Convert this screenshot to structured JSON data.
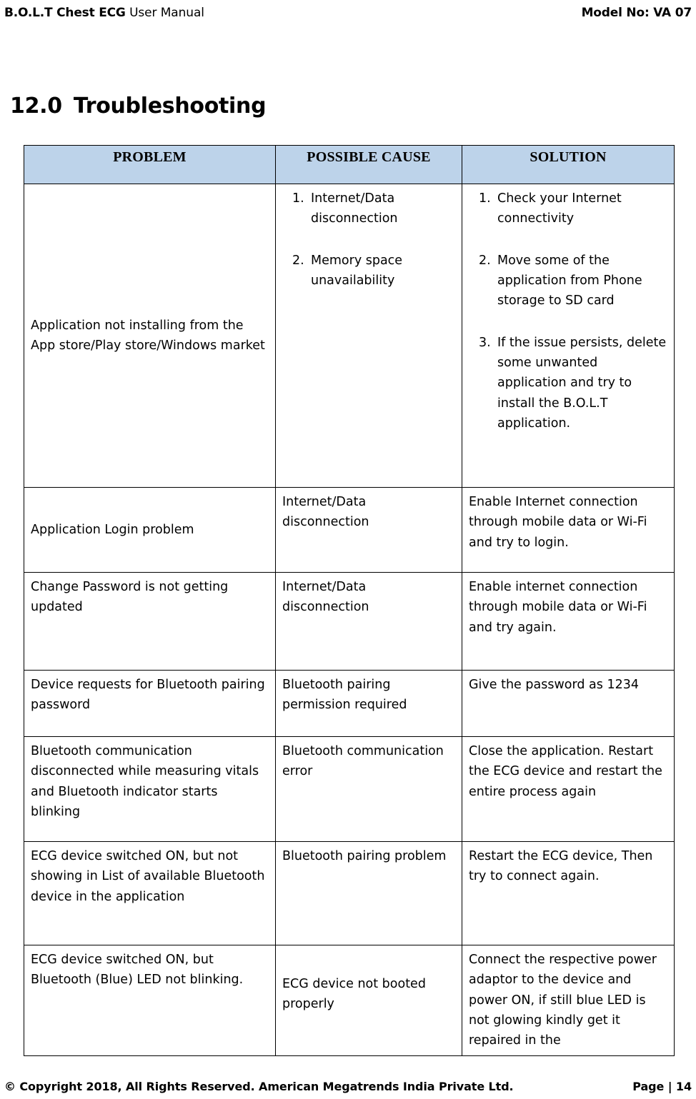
{
  "header": {
    "brand": "B.O.L.T Chest ECG",
    "subtitle": "User Manual",
    "model": "Model No: VA 07"
  },
  "section": {
    "number": "12.0",
    "title": "Troubleshooting"
  },
  "table": {
    "columns": [
      "PROBLEM",
      "POSSIBLE CAUSE",
      "SOLUTION"
    ],
    "header_fill": "#bdd3ea",
    "rows": [
      {
        "problem": "Application not installing from the App store/Play store/Windows market",
        "cause_list": [
          {
            "num": "1.",
            "text": "Internet/Data disconnection"
          },
          {
            "num": "2.",
            "text": "Memory space unavailability"
          }
        ],
        "solution_list": [
          {
            "num": "1.",
            "text": "Check your Internet connectivity"
          },
          {
            "num": "2.",
            "text": "Move some of the application from Phone storage to SD card"
          },
          {
            "num": "3.",
            "text": "If the issue persists, delete some unwanted application and try to install the B.O.L.T application."
          }
        ]
      },
      {
        "problem": "Application Login problem",
        "cause": "Internet/Data disconnection",
        "solution": "Enable Internet connection through mobile data or Wi-Fi and try to login."
      },
      {
        "problem": "Change Password is not getting updated",
        "cause": "Internet/Data disconnection",
        "solution": "Enable internet connection through mobile data or Wi-Fi and try again."
      },
      {
        "problem": "Device requests for Bluetooth pairing password",
        "cause": "Bluetooth pairing permission required",
        "solution": "Give the password as 1234"
      },
      {
        "problem": "Bluetooth communication disconnected while measuring vitals and Bluetooth indicator starts blinking",
        "cause": "Bluetooth communication error",
        "solution": "Close the application. Restart the ECG device and restart the entire process again"
      },
      {
        "problem": "ECG device switched ON, but not showing in List of available Bluetooth device in the application",
        "cause": "Bluetooth pairing problem",
        "solution": "Restart the ECG device, Then try to connect again."
      },
      {
        "problem": "ECG device switched ON, but Bluetooth (Blue) LED not blinking.",
        "cause": "ECG device not booted properly",
        "solution": "Connect the respective power adaptor to the device and power ON, if still blue LED is not glowing kindly get it repaired in the"
      }
    ]
  },
  "footer": {
    "copyright": "© Copyright 2018, All Rights Reserved. American Megatrends India Private Ltd.",
    "page": "Page | 14"
  }
}
